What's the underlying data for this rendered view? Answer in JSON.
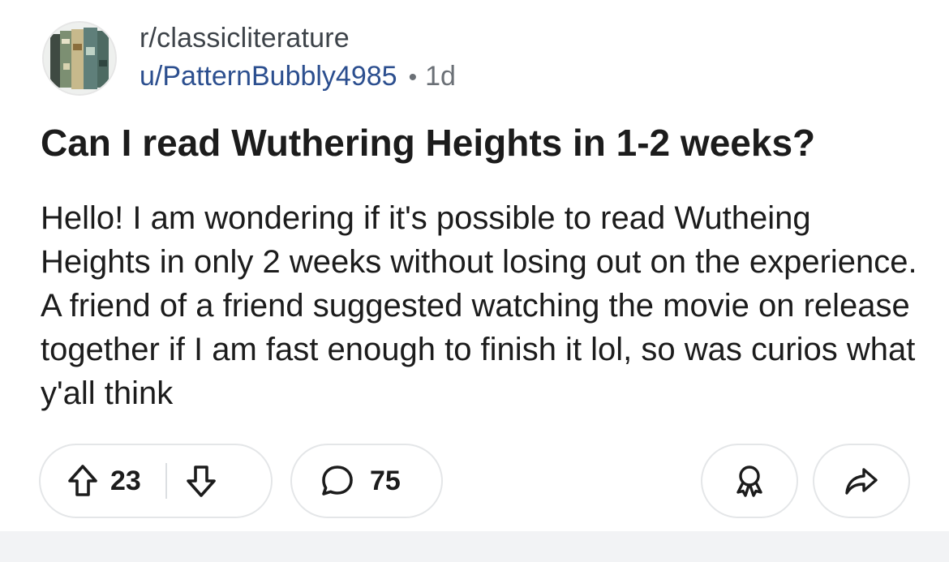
{
  "post": {
    "subreddit": "r/classicliterature",
    "author": "u/PatternBubbly4985",
    "separator": "•",
    "age": "1d",
    "title": "Can I read Wuthering Heights in 1-2 weeks?",
    "body": "Hello! I am wondering if it's possible to read Wutheing Heights in only 2 weeks without losing out on the experience. A friend of a friend suggested watching the movie on release together if I am fast enough to finish it lol, so was curios what y'all think"
  },
  "actions": {
    "upvotes": "23",
    "comments": "75",
    "icons": {
      "upvote": "arrow-up-icon",
      "downvote": "arrow-down-icon",
      "comment": "speech-bubble-icon",
      "award": "award-ribbon-icon",
      "share": "share-arrow-icon"
    }
  },
  "colors": {
    "username": "#2c4f8f",
    "muted": "#6b7076",
    "pill_border": "#e4e6e8",
    "footer_bg": "#f2f3f5"
  }
}
